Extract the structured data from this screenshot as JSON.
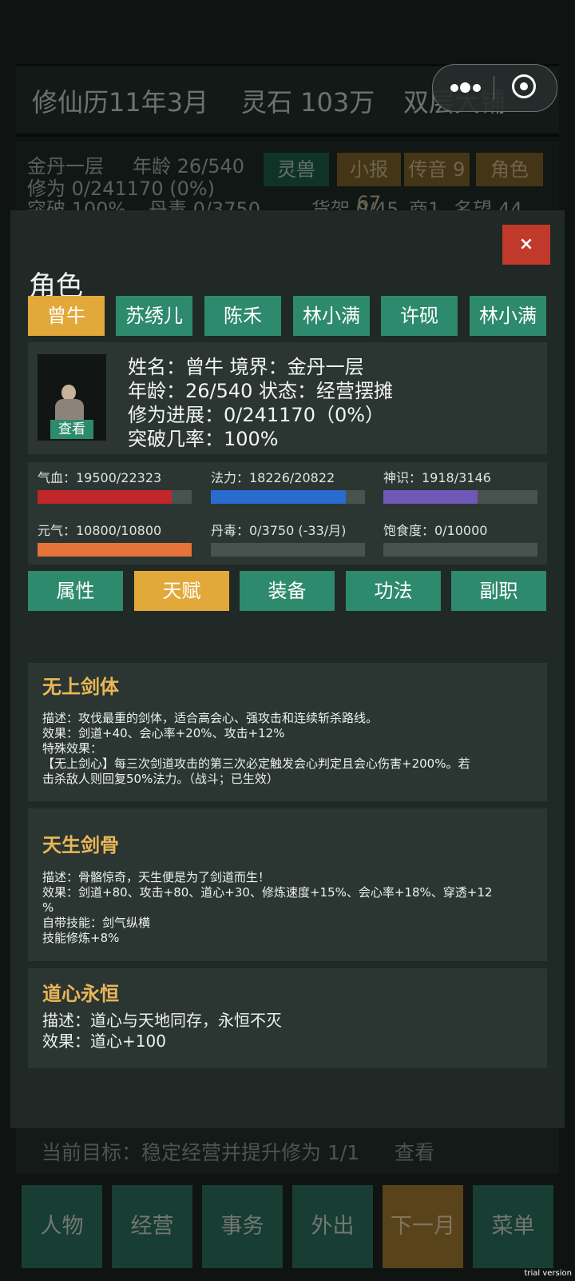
{
  "background": {
    "calendar": "修仙历11年3月",
    "spirit_stones": "灵石 103万",
    "shop_name": "双层大铺",
    "realm": "金丹一层",
    "age": "年龄 26/540",
    "cultivation": "修为 0/241170 (0%)",
    "breakthrough": "突破 100%",
    "pill_poison": "丹毒 0/3750",
    "shelves": "货架 0/45",
    "shop_count": "商1",
    "fame": "名望 44",
    "btn_beast": "灵兽",
    "btn_news": "小报 67",
    "btn_message": "传音 9",
    "btn_role": "角色",
    "goal_text": "当前目标：稳定经营并提升修为 1/1",
    "goal_view": "查看",
    "nav": [
      "人物",
      "经营",
      "事务",
      "外出",
      "下一月",
      "菜单"
    ],
    "trial_text": "trial version"
  },
  "modal": {
    "close_label": "×",
    "title": "角色",
    "characters": [
      "曾牛",
      "苏绣儿",
      "陈禾",
      "林小满",
      "许砚",
      "林小满"
    ],
    "active_character": 0,
    "portrait_button": "查看",
    "info": {
      "line1": "姓名：曾牛    境界：金丹一层",
      "line2": "年龄：26/540    状态：经营摆摊",
      "line3": "修为进展：0/241170（0%）",
      "line4": "突破几率：100%"
    },
    "stats": [
      {
        "label": "气血：19500/22323",
        "ratio": 0.873,
        "color": "#c0262a"
      },
      {
        "label": "法力：18226/20822",
        "ratio": 0.875,
        "color": "#2a6bd0"
      },
      {
        "label": "神识：1918/3146",
        "ratio": 0.61,
        "color": "#6f58b8"
      },
      {
        "label": "元气：10800/10800",
        "ratio": 1.0,
        "color": "#e5733a"
      },
      {
        "label": "丹毒：0/3750 (-33/月)",
        "ratio": 0.0,
        "color": "#7a8a80"
      },
      {
        "label": "饱食度：0/10000",
        "ratio": 0.0,
        "color": "#7a8a80"
      }
    ],
    "sections": [
      "属性",
      "天赋",
      "装备",
      "功法",
      "副职"
    ],
    "active_section": 1,
    "talents": [
      {
        "name": "无上剑体",
        "lines": [
          "描述：攻伐最重的剑体，适合高会心、强攻击和连续斩杀路线。",
          "效果：剑道+40、会心率+20%、攻击+12%",
          "特殊效果：",
          "【无上剑心】每三次剑道攻击的第三次必定触发会心判定且会心伤害+200%。若",
          "击杀敌人则回复50%法力。（战斗；已生效）"
        ]
      },
      {
        "name": "天生剑骨",
        "lines": [
          "描述：骨骼惊奇，天生便是为了剑道而生！",
          "效果：剑道+80、攻击+80、道心+30、修炼速度+15%、会心率+18%、穿透+12",
          "%",
          "自带技能：剑气纵横",
          "技能修炼+8%"
        ]
      },
      {
        "name": "道心永恒",
        "lines": [
          "描述：道心与天地同存，永恒不灭",
          "效果：道心+100"
        ]
      }
    ]
  }
}
